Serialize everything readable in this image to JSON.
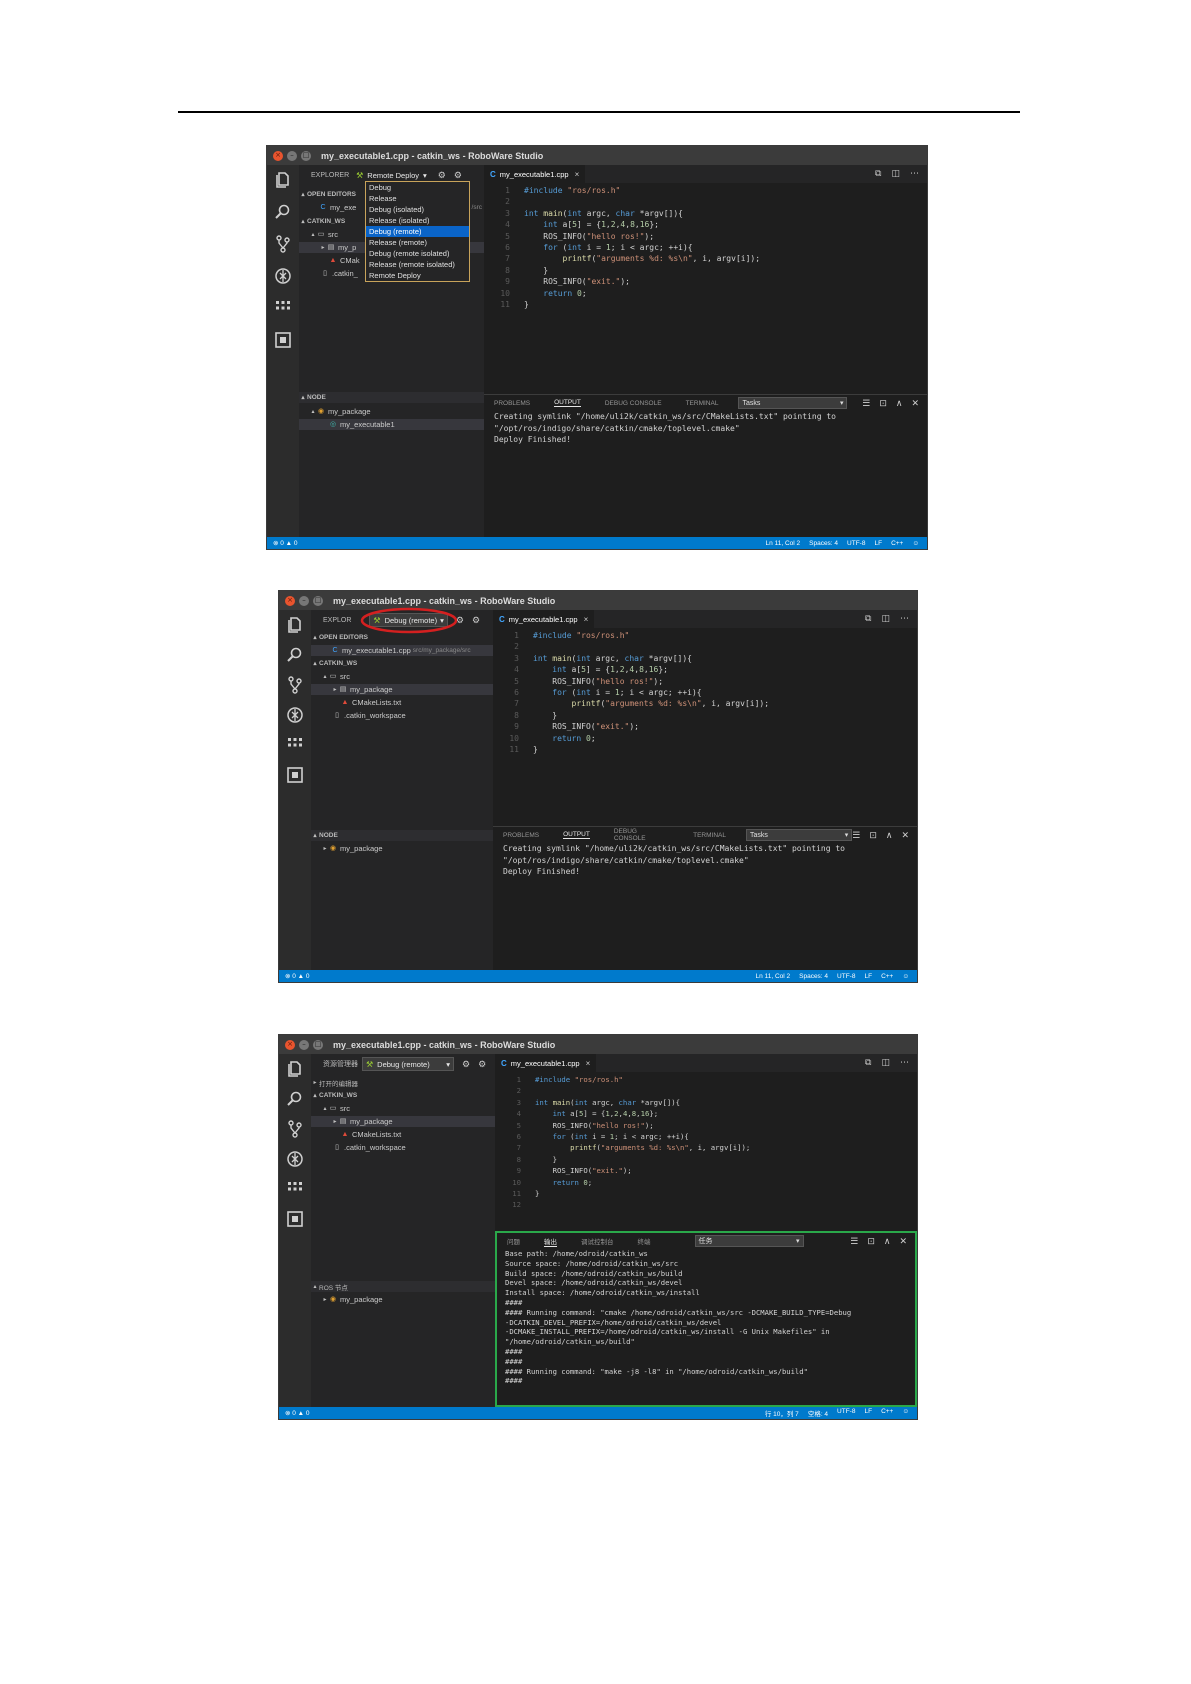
{
  "icons": {
    "explorer": "files-icon",
    "search": "search-icon",
    "git": "source-control-icon",
    "debug": "debug-icon",
    "extensions": "extensions-icon",
    "ros": "ros-icon"
  },
  "shot1": {
    "window_title": "my_executable1.cpp - catkin_ws - RoboWare Studio",
    "explorer_label": "EXPLORER",
    "build_config": "Remote Deploy",
    "dropdown_options": [
      "Debug",
      "Release",
      "Debug (isolated)",
      "Release (isolated)",
      "Debug (remote)",
      "Release (remote)",
      "Debug (remote isolated)",
      "Release (remote isolated)",
      "Remote Deploy"
    ],
    "dropdown_selected": "Debug (remote)",
    "open_editors": "OPEN EDITORS",
    "open_file_fragment": "my_exe",
    "open_file_path_fragment": "/src",
    "workspace": "CATKIN_WS",
    "src": "src",
    "pkg_fragment": "my_p",
    "cmake_fragment": "CMak",
    "catkin_fragment": ".catkin_",
    "node_section": "NODE",
    "node_pkg": "my_package",
    "node_exec": "my_executable1",
    "tab": "my_executable1.cpp",
    "panel_tabs": [
      "PROBLEMS",
      "OUTPUT",
      "DEBUG CONSOLE",
      "TERMINAL"
    ],
    "panel_active": "OUTPUT",
    "task": "Tasks",
    "output": [
      "Creating symlink \"/home/uli2k/catkin_ws/src/CMakeLists.txt\" pointing to",
      "\"/opt/ros/indigo/share/catkin/cmake/toplevel.cmake\"",
      "Deploy Finished!"
    ],
    "status_left": "⊗ 0 ▲ 0",
    "status_right": [
      "Ln 11, Col 2",
      "Spaces: 4",
      "UTF-8",
      "LF",
      "C++",
      "☺"
    ]
  },
  "shot2": {
    "window_title": "my_executable1.cpp - catkin_ws - RoboWare Studio",
    "explorer_label": "EXPLOR",
    "build_config": "Debug (remote)",
    "open_editors": "OPEN EDITORS",
    "open_file": "my_executable1.cpp",
    "open_file_path": "src/my_package/src",
    "workspace": "CATKIN_WS",
    "src": "src",
    "pkg": "my_package",
    "cmake": "CMakeLists.txt",
    "catkin": ".catkin_workspace",
    "node_section": "NODE",
    "node_pkg": "my_package",
    "tab": "my_executable1.cpp",
    "panel_tabs": [
      "PROBLEMS",
      "OUTPUT",
      "DEBUG CONSOLE",
      "TERMINAL"
    ],
    "panel_active": "OUTPUT",
    "task": "Tasks",
    "output": [
      "Creating symlink \"/home/uli2k/catkin_ws/src/CMakeLists.txt\" pointing to",
      "\"/opt/ros/indigo/share/catkin/cmake/toplevel.cmake\"",
      "Deploy Finished!"
    ],
    "status_left": "⊗ 0 ▲ 0",
    "status_right": [
      "Ln 11, Col 2",
      "Spaces: 4",
      "UTF-8",
      "LF",
      "C++",
      "☺"
    ]
  },
  "shot3": {
    "window_title": "my_executable1.cpp - catkin_ws - RoboWare Studio",
    "explorer_label": "资源管理器",
    "build_config": "Debug (remote)",
    "open_editors": "打开的编辑器",
    "workspace": "CATKIN_WS",
    "src": "src",
    "pkg": "my_package",
    "cmake": "CMakeLists.txt",
    "catkin": ".catkin_workspace",
    "node_section": "ROS 节点",
    "node_pkg": "my_package",
    "tab": "my_executable1.cpp",
    "panel_tabs": [
      "问题",
      "输出",
      "调试控制台",
      "终端"
    ],
    "panel_active": "输出",
    "task": "任务",
    "output": [
      "Base path: /home/odroid/catkin_ws",
      "Source space: /home/odroid/catkin_ws/src",
      "Build space: /home/odroid/catkin_ws/build",
      "Devel space: /home/odroid/catkin_ws/devel",
      "Install space: /home/odroid/catkin_ws/install",
      "####",
      "#### Running command: \"cmake /home/odroid/catkin_ws/src -DCMAKE_BUILD_TYPE=Debug",
      "-DCATKIN_DEVEL_PREFIX=/home/odroid/catkin_ws/devel",
      "-DCMAKE_INSTALL_PREFIX=/home/odroid/catkin_ws/install -G Unix Makefiles\" in",
      "\"/home/odroid/catkin_ws/build\"",
      "####",
      "####",
      "#### Running command: \"make -j8 -l8\" in \"/home/odroid/catkin_ws/build\"",
      "####"
    ],
    "status_left": "⊗ 0 ▲ 0",
    "status_right": [
      "行 10，列 7",
      "空格: 4",
      "UTF-8",
      "LF",
      "C++",
      "☺"
    ]
  }
}
